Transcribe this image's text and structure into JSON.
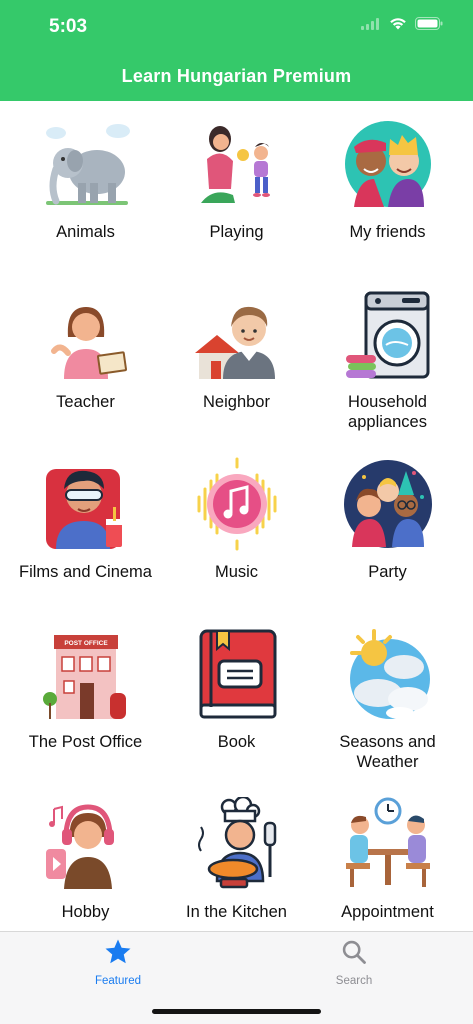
{
  "status_bar": {
    "time": "5:03"
  },
  "nav": {
    "title": "Learn Hungarian Premium"
  },
  "categories": [
    {
      "label": "Animals",
      "icon": "elephant-icon"
    },
    {
      "label": "Playing",
      "icon": "mother-child-playing-icon"
    },
    {
      "label": "My friends",
      "icon": "friends-icon"
    },
    {
      "label": "Teacher",
      "icon": "teacher-icon"
    },
    {
      "label": "Neighbor",
      "icon": "neighbor-icon"
    },
    {
      "label": "Household appliances",
      "icon": "washing-machine-icon"
    },
    {
      "label": "Films and Cinema",
      "icon": "cinema-viewer-icon"
    },
    {
      "label": "Music",
      "icon": "music-note-icon"
    },
    {
      "label": "Party",
      "icon": "party-people-icon"
    },
    {
      "label": "The Post Office",
      "icon": "post-office-building-icon",
      "sign": "POST OFFICE"
    },
    {
      "label": "Book",
      "icon": "book-icon"
    },
    {
      "label": "Seasons and Weather",
      "icon": "sun-cloud-icon"
    },
    {
      "label": "Hobby",
      "icon": "hobby-music-icon"
    },
    {
      "label": "In the Kitchen",
      "icon": "chef-cooking-icon"
    },
    {
      "label": "Appointment",
      "icon": "meeting-appointment-icon"
    }
  ],
  "tabbar": {
    "featured_label": "Featured",
    "search_label": "Search"
  },
  "colors": {
    "header": "#35c96a",
    "active_tab": "#1a7cf0",
    "inactive_tab": "#8e8e93"
  }
}
